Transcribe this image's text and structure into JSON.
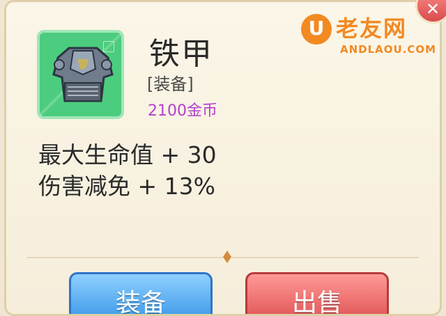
{
  "item": {
    "name": "铁甲",
    "type": "[装备]",
    "price": "2100金币",
    "icon": "iron-armor-icon"
  },
  "stats": [
    "最大生命值 + 30",
    "伤害减免 + 13%"
  ],
  "buttons": {
    "equip": "装备",
    "sell": "出售"
  },
  "watermark": {
    "mark": "U",
    "name": "老友网",
    "url": "ANDLAOU.COM"
  },
  "colors": {
    "price": "#b53fd0",
    "equip_button": "#3e9ae8",
    "sell_button": "#e05656",
    "icon_bg": "#4ccc7e"
  }
}
